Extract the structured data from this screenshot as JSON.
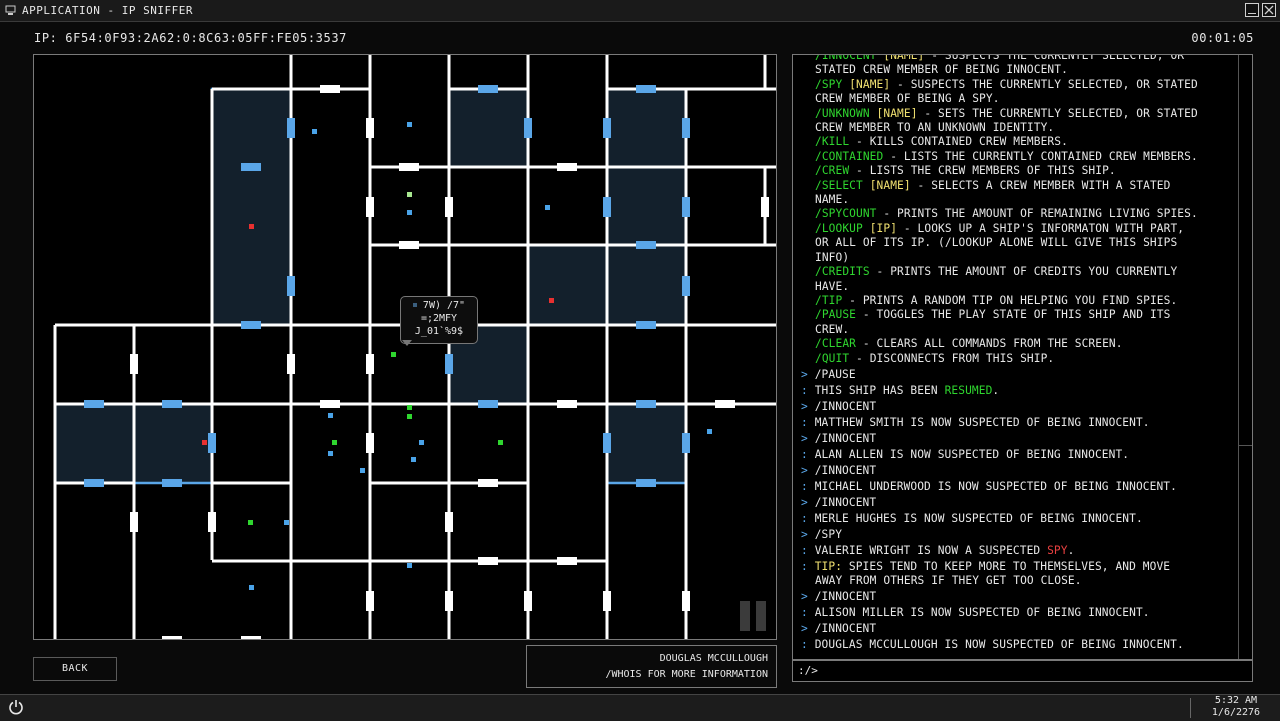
{
  "window": {
    "title": "APPLICATION - IP SNIFFER"
  },
  "header": {
    "ip_label": "IP: 6F54:0F93:2A62:0:8C63:05FF:FE05:3537",
    "timer": "00:01:05"
  },
  "map": {
    "tooltip": {
      "line1": "7W) /7\"",
      "line2": "=;2MFY",
      "line3": "J_01`%9$"
    }
  },
  "footer": {
    "back_label": "BACK",
    "selected_name": "DOUGLAS MCCULLOUGH",
    "selected_hint": "/WHOIS FOR MORE INFORMATION"
  },
  "console": {
    "help": [
      {
        "cmd": "/INNOCENT",
        "param": "[NAME]",
        "lines": [
          " - SUSPECTS THE CURRENTLY SELECTED, OR",
          "STATED CREW MEMBER OF BEING INNOCENT."
        ]
      },
      {
        "cmd": "/SPY",
        "param": "[NAME]",
        "lines": [
          " - SUSPECTS THE CURRENTLY SELECTED, OR STATED",
          "CREW MEMBER OF BEING A SPY."
        ]
      },
      {
        "cmd": "/UNKNOWN",
        "param": "[NAME]",
        "lines": [
          " - SETS THE CURRENTLY SELECTED, OR STATED",
          "CREW MEMBER TO AN UNKNOWN IDENTITY."
        ]
      },
      {
        "cmd": "/KILL",
        "param": "",
        "lines": [
          " - KILLS CONTAINED CREW MEMBERS."
        ]
      },
      {
        "cmd": "/CONTAINED",
        "param": "",
        "lines": [
          " - LISTS THE CURRENTLY CONTAINED CREW MEMBERS."
        ]
      },
      {
        "cmd": "/CREW",
        "param": "",
        "lines": [
          " - LISTS THE CREW MEMBERS OF THIS SHIP."
        ]
      },
      {
        "cmd": "/SELECT",
        "param": "[NAME]",
        "lines": [
          " - SELECTS A CREW MEMBER WITH A STATED",
          "NAME."
        ]
      },
      {
        "cmd": "/SPYCOUNT",
        "param": "",
        "lines": [
          " - PRINTS THE AMOUNT OF REMAINING LIVING SPIES."
        ]
      },
      {
        "cmd": "/LOOKUP",
        "param": "[IP]",
        "lines": [
          " - LOOKS UP A SHIP'S INFORMATON WITH PART,",
          "OR ALL OF ITS IP. (/LOOKUP ALONE WILL GIVE THIS SHIPS",
          "INFO)"
        ]
      },
      {
        "cmd": "/CREDITS",
        "param": "",
        "lines": [
          " - PRINTS THE AMOUNT OF CREDITS YOU CURRENTLY",
          "HAVE."
        ]
      },
      {
        "cmd": "/TIP",
        "param": "",
        "lines": [
          " - PRINTS A RANDOM TIP ON HELPING YOU FIND SPIES."
        ]
      },
      {
        "cmd": "/PAUSE",
        "param": "",
        "lines": [
          " - TOGGLES THE PLAY STATE OF THIS SHIP AND ITS",
          "CREW."
        ]
      },
      {
        "cmd": "/CLEAR",
        "param": "",
        "lines": [
          " - CLEARS ALL COMMANDS FROM THE SCREEN."
        ]
      },
      {
        "cmd": "/QUIT",
        "param": "",
        "lines": [
          " - DISCONNECTS FROM THIS SHIP."
        ]
      }
    ],
    "log": [
      {
        "prefix": ">",
        "parts": [
          {
            "t": "/PAUSE"
          }
        ]
      },
      {
        "prefix": ":",
        "parts": [
          {
            "t": "THIS SHIP HAS BEEN "
          },
          {
            "t": "RESUMED",
            "c": "green"
          },
          {
            "t": "."
          }
        ]
      },
      {
        "prefix": ">",
        "parts": [
          {
            "t": "/INNOCENT"
          }
        ]
      },
      {
        "prefix": ":",
        "parts": [
          {
            "t": "MATTHEW SMITH IS NOW SUSPECTED OF BEING INNOCENT."
          }
        ]
      },
      {
        "prefix": ">",
        "parts": [
          {
            "t": "/INNOCENT"
          }
        ]
      },
      {
        "prefix": ":",
        "parts": [
          {
            "t": "ALAN ALLEN IS NOW SUSPECTED OF BEING INNOCENT."
          }
        ]
      },
      {
        "prefix": ">",
        "parts": [
          {
            "t": "/INNOCENT"
          }
        ]
      },
      {
        "prefix": ":",
        "parts": [
          {
            "t": "MICHAEL UNDERWOOD IS NOW SUSPECTED OF BEING INNOCENT."
          }
        ]
      },
      {
        "prefix": ">",
        "parts": [
          {
            "t": "/INNOCENT"
          }
        ]
      },
      {
        "prefix": ":",
        "parts": [
          {
            "t": "MERLE HUGHES IS NOW SUSPECTED OF BEING INNOCENT."
          }
        ]
      },
      {
        "prefix": ">",
        "parts": [
          {
            "t": "/SPY"
          }
        ]
      },
      {
        "prefix": ":",
        "parts": [
          {
            "t": "VALERIE WRIGHT IS NOW A SUSPECTED "
          },
          {
            "t": "SPY",
            "c": "red"
          },
          {
            "t": "."
          }
        ]
      },
      {
        "prefix": ":",
        "parts": [
          {
            "t": "TIP:",
            "c": "yellow"
          },
          {
            "t": " SPIES TEND TO KEEP MORE TO THEMSELVES, AND MOVE"
          }
        ],
        "extra": [
          "AWAY FROM OTHERS IF THEY GET TOO CLOSE."
        ]
      },
      {
        "prefix": ">",
        "parts": [
          {
            "t": "/INNOCENT"
          }
        ]
      },
      {
        "prefix": ":",
        "parts": [
          {
            "t": "ALISON MILLER IS NOW SUSPECTED OF BEING INNOCENT."
          }
        ]
      },
      {
        "prefix": ">",
        "parts": [
          {
            "t": "/INNOCENT"
          }
        ]
      },
      {
        "prefix": ":",
        "parts": [
          {
            "t": "DOUGLAS MCCULLOUGH IS NOW SUSPECTED OF BEING INNOCENT."
          }
        ]
      }
    ],
    "input_prompt": ":/>"
  },
  "taskbar": {
    "time": "5:32 AM",
    "date": "1/6/2276"
  },
  "colors": {
    "command": "#2fd62f",
    "param": "#f0e070",
    "prompt": "#5aa6e8",
    "wall": "#ffffff",
    "room_highlight": "#5aa6e8",
    "room_fill": "#13202c",
    "crew_innocent": "#2fd62f",
    "crew_spy": "#e83030",
    "crew_unknown": "#4aa3e8"
  },
  "icons": {
    "app": "computer-icon",
    "minimize": "minimize-icon",
    "close": "close-icon",
    "power": "power-icon",
    "pause": "pause-icon"
  }
}
